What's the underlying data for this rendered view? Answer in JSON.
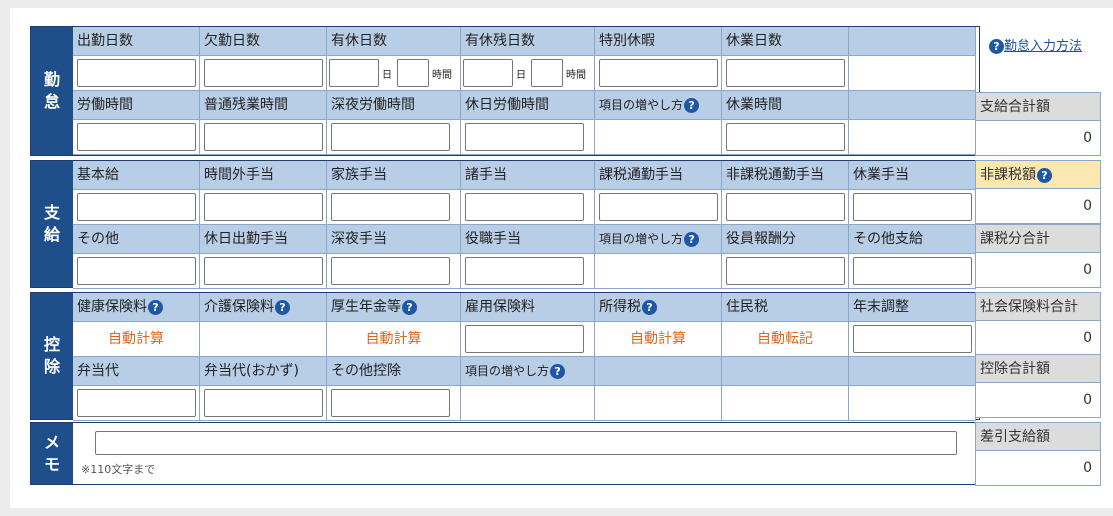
{
  "sections": {
    "kintai": {
      "label": "勤\n怠"
    },
    "shikyu": {
      "label": "支\n給"
    },
    "koujo": {
      "label": "控\n除"
    },
    "memo": {
      "label": "メ\nモ"
    }
  },
  "help_link": "勤怠入力方法",
  "kintai": {
    "row1": [
      "出勤日数",
      "欠勤日数",
      "有休日数",
      "有休残日数",
      "特別休暇",
      "休業日数",
      ""
    ],
    "row2": [
      "労働時間",
      "普通残業時間",
      "深夜労働時間",
      "休日労働時間",
      "項目の増やし方",
      "休業時間",
      ""
    ],
    "unit_day": "日",
    "unit_hour": "時間"
  },
  "shikyu": {
    "row1": [
      "基本給",
      "時間外手当",
      "家族手当",
      "諸手当",
      "課税通勤手当",
      "非課税通勤手当",
      "休業手当"
    ],
    "row2": [
      "その他",
      "休日出勤手当",
      "深夜手当",
      "役職手当",
      "項目の増やし方",
      "役員報酬分",
      "その他支給"
    ]
  },
  "koujo": {
    "row1": [
      "健康保険料",
      "介護保険料",
      "厚生年金等",
      "雇用保険料",
      "所得税",
      "住民税",
      "年末調整"
    ],
    "row2": [
      "弁当代",
      "弁当代(おかず)",
      "その他控除",
      "項目の増やし方",
      "",
      "",
      ""
    ],
    "auto_calc": "自動計算",
    "auto_transfer": "自動転記"
  },
  "memo": {
    "note": "※110文字まで",
    "value": ""
  },
  "totals": {
    "shikyu_total": {
      "label": "支給合計額",
      "value": "0"
    },
    "hikazei": {
      "label": "非課税額",
      "value": "0"
    },
    "kazei": {
      "label": "課税分合計",
      "value": "0"
    },
    "shakai": {
      "label": "社会保険料合計",
      "value": "0"
    },
    "koujo_total": {
      "label": "控除合計額",
      "value": "0"
    },
    "sashihiki": {
      "label": "差引支給額",
      "value": "0"
    }
  }
}
